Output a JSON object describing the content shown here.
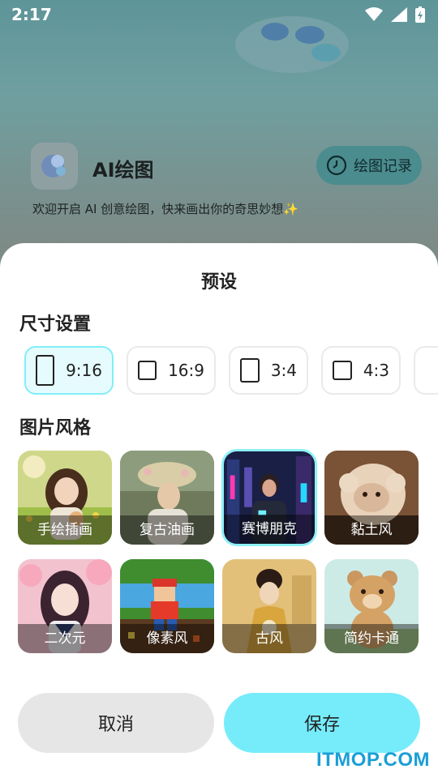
{
  "status_bar": {
    "time": "2:17"
  },
  "background_app": {
    "title": "AI绘图",
    "history_button": "绘图记录",
    "welcome_text": "欢迎开启 AI 创意绘图，快来画出你的奇思妙想✨"
  },
  "sheet": {
    "title": "预设",
    "size_section_title": "尺寸设置",
    "sizes": [
      {
        "label": "9:16",
        "selected": true
      },
      {
        "label": "16:9",
        "selected": false
      },
      {
        "label": "3:4",
        "selected": false
      },
      {
        "label": "4:3",
        "selected": false
      }
    ],
    "style_section_title": "图片风格",
    "styles": [
      {
        "label": "手绘插画",
        "selected": false
      },
      {
        "label": "复古油画",
        "selected": false
      },
      {
        "label": "赛博朋克",
        "selected": true
      },
      {
        "label": "黏土风",
        "selected": false
      },
      {
        "label": "二次元",
        "selected": false
      },
      {
        "label": "像素风",
        "selected": false
      },
      {
        "label": "古风",
        "selected": false
      },
      {
        "label": "简约卡通",
        "selected": false
      }
    ],
    "cancel_button": "取消",
    "save_button": "保存"
  },
  "watermark": "ITMOP.COM",
  "colors": {
    "accent": "#76ecfb",
    "selected_border": "#82eef7",
    "cancel_bg": "#e6e6e6"
  }
}
